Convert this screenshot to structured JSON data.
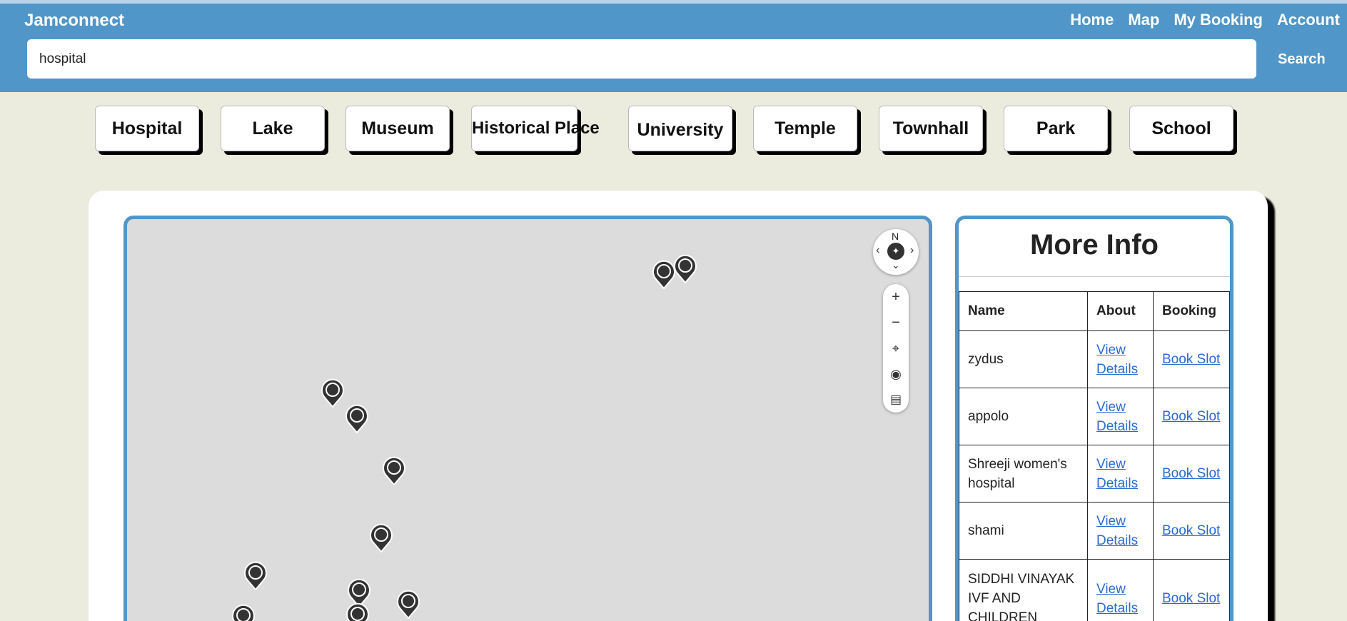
{
  "header": {
    "brand": "Jamconnect",
    "nav": [
      "Home",
      "Map",
      "My Booking",
      "Account"
    ],
    "search_value": "hospital",
    "search_button": "Search"
  },
  "categories": [
    "Hospital",
    "Lake",
    "Museum",
    "Historical Place",
    "University",
    "Temple",
    "Townhall",
    "Park",
    "School"
  ],
  "map": {
    "compass_label": "N"
  },
  "info": {
    "title": "More Info",
    "columns": [
      "Name",
      "About",
      "Booking"
    ],
    "rows": [
      {
        "name": "zydus",
        "about": "View Details",
        "booking": "Book Slot"
      },
      {
        "name": "appolo",
        "about": "View Details",
        "booking": "Book Slot"
      },
      {
        "name": "Shreeji women's hospital",
        "about": "View Details",
        "booking": "Book Slot"
      },
      {
        "name": "shami",
        "about": "View Details",
        "booking": "Book Slot"
      },
      {
        "name": "SIDDHI VINAYAK IVF AND CHILDREN",
        "about": "View Details",
        "booking": "Book Slot"
      }
    ]
  }
}
